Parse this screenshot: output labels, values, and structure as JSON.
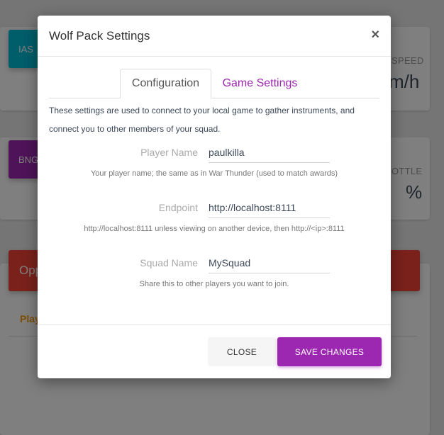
{
  "background": {
    "tiles": [
      {
        "label": "IAS",
        "color": "#00bcd4"
      },
      {
        "label": "BNG",
        "color": "#9c27b0"
      }
    ],
    "speed_label": "SPEED",
    "speed_value": "m/h",
    "throttle_label": "OTTLE",
    "throttle_value": "%",
    "red_bar_label": "Opp",
    "red_color": "#f44336",
    "player_header": "Play",
    "orange_color": "#ff9800"
  },
  "modal": {
    "title": "Wolf Pack Settings",
    "close_symbol": "×",
    "tabs": [
      {
        "label": "Configuration",
        "active": true
      },
      {
        "label": "Game Settings",
        "active": false
      }
    ],
    "description": "These settings are used to connect to your local game to gather instruments, and connect you to other members of your squad.",
    "fields": {
      "player_name": {
        "label": "Player Name",
        "value": "paulkilla",
        "help": "Your player name; the same as in War Thunder (used to match awards)"
      },
      "endpoint": {
        "label": "Endpoint",
        "value": "http://localhost:8111",
        "help": "http://localhost:8111 unless viewing on another device, then http://<ip>:8111"
      },
      "squad_name": {
        "label": "Squad Name",
        "value": "MySquad",
        "help": "Share this to other players you want to join."
      }
    },
    "buttons": {
      "close": "CLOSE",
      "save": "SAVE CHANGES"
    },
    "accent_color": "#9c27b0"
  }
}
